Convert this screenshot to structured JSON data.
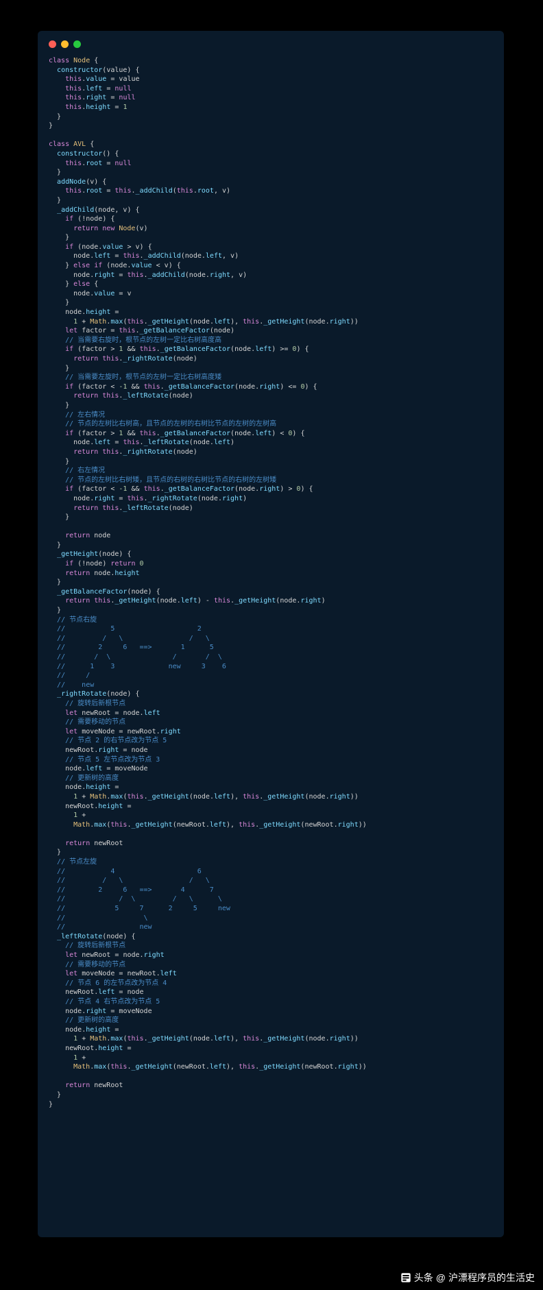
{
  "footer": {
    "brand": "头条",
    "at": "@",
    "name": "沪漂程序员的生活史"
  },
  "code": {
    "lines": [
      {
        "t": "<kw>class</kw> <nm>Node</nm> {"
      },
      {
        "t": "  <fn>constructor</fn>(<id>value</id>) {"
      },
      {
        "t": "    <kw>this</kw>.<prop>value</prop> <op>=</op> <id>value</id>"
      },
      {
        "t": "    <kw>this</kw>.<prop>left</prop> <op>=</op> <null>null</null>"
      },
      {
        "t": "    <kw>this</kw>.<prop>right</prop> <op>=</op> <null>null</null>"
      },
      {
        "t": "    <kw>this</kw>.<prop>height</prop> <op>=</op> <num>1</num>"
      },
      {
        "t": "  }"
      },
      {
        "t": "}"
      },
      {
        "t": ""
      },
      {
        "t": "<kw>class</kw> <nm>AVL</nm> {"
      },
      {
        "t": "  <fn>constructor</fn>() {"
      },
      {
        "t": "    <kw>this</kw>.<prop>root</prop> <op>=</op> <null>null</null>"
      },
      {
        "t": "  }"
      },
      {
        "t": "  <fn>addNode</fn>(<id>v</id>) {"
      },
      {
        "t": "    <kw>this</kw>.<prop>root</prop> <op>=</op> <kw>this</kw>.<fn>_addChild</fn>(<kw>this</kw>.<prop>root</prop>, <id>v</id>)"
      },
      {
        "t": "  }"
      },
      {
        "t": "  <fn>_addChild</fn>(<id>node</id>, <id>v</id>) {"
      },
      {
        "t": "    <kw>if</kw> (<op>!</op><id>node</id>) {"
      },
      {
        "t": "      <kw>return</kw> <kw>new</kw> <nm>Node</nm>(<id>v</id>)"
      },
      {
        "t": "    }"
      },
      {
        "t": "    <kw>if</kw> (<id>node</id>.<prop>value</prop> <op>&gt;</op> <id>v</id>) {"
      },
      {
        "t": "      <id>node</id>.<prop>left</prop> <op>=</op> <kw>this</kw>.<fn>_addChild</fn>(<id>node</id>.<prop>left</prop>, <id>v</id>)"
      },
      {
        "t": "    } <kw>else if</kw> (<id>node</id>.<prop>value</prop> <op>&lt;</op> <id>v</id>) {"
      },
      {
        "t": "      <id>node</id>.<prop>right</prop> <op>=</op> <kw>this</kw>.<fn>_addChild</fn>(<id>node</id>.<prop>right</prop>, <id>v</id>)"
      },
      {
        "t": "    } <kw>else</kw> {"
      },
      {
        "t": "      <id>node</id>.<prop>value</prop> <op>=</op> <id>v</id>"
      },
      {
        "t": "    }"
      },
      {
        "t": "    <id>node</id>.<prop>height</prop> <op>=</op>"
      },
      {
        "t": "      <num>1</num> <op>+</op> <nm>Math</nm>.<fn>max</fn>(<kw>this</kw>.<fn>_getHeight</fn>(<id>node</id>.<prop>left</prop>), <kw>this</kw>.<fn>_getHeight</fn>(<id>node</id>.<prop>right</prop>))"
      },
      {
        "t": "    <kw>let</kw> <id>factor</id> <op>=</op> <kw>this</kw>.<fn>_getBalanceFactor</fn>(<id>node</id>)"
      },
      {
        "t": "    <cm>// 当需要右旋时，根节点的左树一定比右树高度高</cm>"
      },
      {
        "t": "    <kw>if</kw> (<id>factor</id> <op>&gt;</op> <num>1</num> <op>&amp;&amp;</op> <kw>this</kw>.<fn>_getBalanceFactor</fn>(<id>node</id>.<prop>left</prop>) <op>&gt;=</op> <num>0</num>) {"
      },
      {
        "t": "      <kw>return</kw> <kw>this</kw>.<fn>_rightRotate</fn>(<id>node</id>)"
      },
      {
        "t": "    }"
      },
      {
        "t": "    <cm>// 当需要左旋时，根节点的左树一定比右树高度矮</cm>"
      },
      {
        "t": "    <kw>if</kw> (<id>factor</id> <op>&lt;</op> <num>-1</num> <op>&amp;&amp;</op> <kw>this</kw>.<fn>_getBalanceFactor</fn>(<id>node</id>.<prop>right</prop>) <op>&lt;=</op> <num>0</num>) {"
      },
      {
        "t": "      <kw>return</kw> <kw>this</kw>.<fn>_leftRotate</fn>(<id>node</id>)"
      },
      {
        "t": "    }"
      },
      {
        "t": "    <cm>// 左右情况</cm>"
      },
      {
        "t": "    <cm>// 节点的左树比右树高，且节点的左树的右树比节点的左树的左树高</cm>"
      },
      {
        "t": "    <kw>if</kw> (<id>factor</id> <op>&gt;</op> <num>1</num> <op>&amp;&amp;</op> <kw>this</kw>.<fn>_getBalanceFactor</fn>(<id>node</id>.<prop>left</prop>) <op>&lt;</op> <num>0</num>) {"
      },
      {
        "t": "      <id>node</id>.<prop>left</prop> <op>=</op> <kw>this</kw>.<fn>_leftRotate</fn>(<id>node</id>.<prop>left</prop>)"
      },
      {
        "t": "      <kw>return</kw> <kw>this</kw>.<fn>_rightRotate</fn>(<id>node</id>)"
      },
      {
        "t": "    }"
      },
      {
        "t": "    <cm>// 右左情况</cm>"
      },
      {
        "t": "    <cm>// 节点的左树比右树矮，且节点的右树的右树比节点的右树的左树矮</cm>"
      },
      {
        "t": "    <kw>if</kw> (<id>factor</id> <op>&lt;</op> <num>-1</num> <op>&amp;&amp;</op> <kw>this</kw>.<fn>_getBalanceFactor</fn>(<id>node</id>.<prop>right</prop>) <op>&gt;</op> <num>0</num>) {"
      },
      {
        "t": "      <id>node</id>.<prop>right</prop> <op>=</op> <kw>this</kw>.<fn>_rightRotate</fn>(<id>node</id>.<prop>right</prop>)"
      },
      {
        "t": "      <kw>return</kw> <kw>this</kw>.<fn>_leftRotate</fn>(<id>node</id>)"
      },
      {
        "t": "    }"
      },
      {
        "t": ""
      },
      {
        "t": "    <kw>return</kw> <id>node</id>"
      },
      {
        "t": "  }"
      },
      {
        "t": "  <fn>_getHeight</fn>(<id>node</id>) {"
      },
      {
        "t": "    <kw>if</kw> (<op>!</op><id>node</id>) <kw>return</kw> <num>0</num>"
      },
      {
        "t": "    <kw>return</kw> <id>node</id>.<prop>height</prop>"
      },
      {
        "t": "  }"
      },
      {
        "t": "  <fn>_getBalanceFactor</fn>(<id>node</id>) {"
      },
      {
        "t": "    <kw>return</kw> <kw>this</kw>.<fn>_getHeight</fn>(<id>node</id>.<prop>left</prop>) <op>-</op> <kw>this</kw>.<fn>_getHeight</fn>(<id>node</id>.<prop>right</prop>)"
      },
      {
        "t": "  }"
      },
      {
        "t": "  <cm>// 节点右旋</cm>"
      },
      {
        "t": "  <cm>//           5                    2</cm>"
      },
      {
        "t": "  <cm>//         /   \\                /   \\</cm>"
      },
      {
        "t": "  <cm>//        2     6   ==&gt;       1      5</cm>"
      },
      {
        "t": "  <cm>//       /  \\               /       /  \\</cm>"
      },
      {
        "t": "  <cm>//      1    3             new     3    6</cm>"
      },
      {
        "t": "  <cm>//     /</cm>"
      },
      {
        "t": "  <cm>//    new</cm>"
      },
      {
        "t": "  <fn>_rightRotate</fn>(<id>node</id>) {"
      },
      {
        "t": "    <cm>// 旋转后新根节点</cm>"
      },
      {
        "t": "    <kw>let</kw> <id>newRoot</id> <op>=</op> <id>node</id>.<prop>left</prop>"
      },
      {
        "t": "    <cm>// 需要移动的节点</cm>"
      },
      {
        "t": "    <kw>let</kw> <id>moveNode</id> <op>=</op> <id>newRoot</id>.<prop>right</prop>"
      },
      {
        "t": "    <cm>// 节点 2 的右节点改为节点 5</cm>"
      },
      {
        "t": "    <id>newRoot</id>.<prop>right</prop> <op>=</op> <id>node</id>"
      },
      {
        "t": "    <cm>// 节点 5 左节点改为节点 3</cm>"
      },
      {
        "t": "    <id>node</id>.<prop>left</prop> <op>=</op> <id>moveNode</id>"
      },
      {
        "t": "    <cm>// 更新树的高度</cm>"
      },
      {
        "t": "    <id>node</id>.<prop>height</prop> <op>=</op>"
      },
      {
        "t": "      <num>1</num> <op>+</op> <nm>Math</nm>.<fn>max</fn>(<kw>this</kw>.<fn>_getHeight</fn>(<id>node</id>.<prop>left</prop>), <kw>this</kw>.<fn>_getHeight</fn>(<id>node</id>.<prop>right</prop>))"
      },
      {
        "t": "    <id>newRoot</id>.<prop>height</prop> <op>=</op>"
      },
      {
        "t": "      <num>1</num> <op>+</op>"
      },
      {
        "t": "      <nm>Math</nm>.<fn>max</fn>(<kw>this</kw>.<fn>_getHeight</fn>(<id>newRoot</id>.<prop>left</prop>), <kw>this</kw>.<fn>_getHeight</fn>(<id>newRoot</id>.<prop>right</prop>))"
      },
      {
        "t": ""
      },
      {
        "t": "    <kw>return</kw> <id>newRoot</id>"
      },
      {
        "t": "  }"
      },
      {
        "t": "  <cm>// 节点左旋</cm>"
      },
      {
        "t": "  <cm>//           4                    6</cm>"
      },
      {
        "t": "  <cm>//         /   \\                /   \\</cm>"
      },
      {
        "t": "  <cm>//        2     6   ==&gt;       4      7</cm>"
      },
      {
        "t": "  <cm>//             /  \\         /   \\      \\</cm>"
      },
      {
        "t": "  <cm>//            5     7      2     5     new</cm>"
      },
      {
        "t": "  <cm>//                   \\</cm>"
      },
      {
        "t": "  <cm>//                  new</cm>"
      },
      {
        "t": "  <fn>_leftRotate</fn>(<id>node</id>) {"
      },
      {
        "t": "    <cm>// 旋转后新根节点</cm>"
      },
      {
        "t": "    <kw>let</kw> <id>newRoot</id> <op>=</op> <id>node</id>.<prop>right</prop>"
      },
      {
        "t": "    <cm>// 需要移动的节点</cm>"
      },
      {
        "t": "    <kw>let</kw> <id>moveNode</id> <op>=</op> <id>newRoot</id>.<prop>left</prop>"
      },
      {
        "t": "    <cm>// 节点 6 的左节点改为节点 4</cm>"
      },
      {
        "t": "    <id>newRoot</id>.<prop>left</prop> <op>=</op> <id>node</id>"
      },
      {
        "t": "    <cm>// 节点 4 右节点改为节点 5</cm>"
      },
      {
        "t": "    <id>node</id>.<prop>right</prop> <op>=</op> <id>moveNode</id>"
      },
      {
        "t": "    <cm>// 更新树的高度</cm>"
      },
      {
        "t": "    <id>node</id>.<prop>height</prop> <op>=</op>"
      },
      {
        "t": "      <num>1</num> <op>+</op> <nm>Math</nm>.<fn>max</fn>(<kw>this</kw>.<fn>_getHeight</fn>(<id>node</id>.<prop>left</prop>), <kw>this</kw>.<fn>_getHeight</fn>(<id>node</id>.<prop>right</prop>))"
      },
      {
        "t": "    <id>newRoot</id>.<prop>height</prop> <op>=</op>"
      },
      {
        "t": "      <num>1</num> <op>+</op>"
      },
      {
        "t": "      <nm>Math</nm>.<fn>max</fn>(<kw>this</kw>.<fn>_getHeight</fn>(<id>newRoot</id>.<prop>left</prop>), <kw>this</kw>.<fn>_getHeight</fn>(<id>newRoot</id>.<prop>right</prop>))"
      },
      {
        "t": ""
      },
      {
        "t": "    <kw>return</kw> <id>newRoot</id>"
      },
      {
        "t": "  }"
      },
      {
        "t": "}"
      }
    ]
  }
}
